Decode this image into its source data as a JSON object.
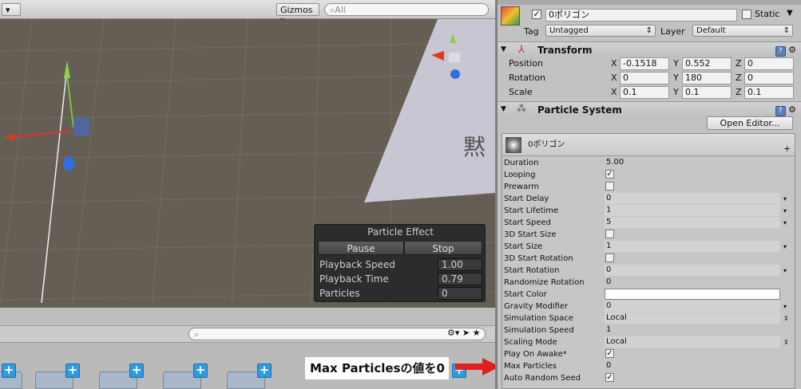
{
  "scene": {
    "gizmos_label": "Gizmos",
    "search_placeholder": "All",
    "background_glyph": "黙"
  },
  "particle_effect": {
    "title": "Particle Effect",
    "pause_label": "Pause",
    "stop_label": "Stop",
    "rows": [
      {
        "label": "Playback Speed",
        "value": "1.00"
      },
      {
        "label": "Playback Time",
        "value": "0.79"
      },
      {
        "label": "Particles",
        "value": "0"
      }
    ]
  },
  "inspector": {
    "object_name": "0ポリゴン",
    "static_label": "Static",
    "tag_label": "Tag",
    "tag_value": "Untagged",
    "layer_label": "Layer",
    "layer_value": "Default",
    "transform": {
      "title": "Transform",
      "rows": [
        {
          "label": "Position",
          "x": "-0.1518",
          "y": "0.552",
          "z": "0"
        },
        {
          "label": "Rotation",
          "x": "0",
          "y": "180",
          "z": "0"
        },
        {
          "label": "Scale",
          "x": "0.1",
          "y": "0.1",
          "z": "0.1"
        }
      ],
      "axis_x": "X",
      "axis_y": "Y",
      "axis_z": "Z"
    },
    "particle_system": {
      "title": "Particle System",
      "open_editor": "Open Editor...",
      "module_name": "0ポリゴン",
      "rows": [
        {
          "label": "Duration",
          "value": "5.00",
          "kind": "text"
        },
        {
          "label": "Looping",
          "value": "✓",
          "kind": "check"
        },
        {
          "label": "Prewarm",
          "value": "",
          "kind": "check"
        },
        {
          "label": "Start Delay",
          "value": "0",
          "kind": "box"
        },
        {
          "label": "Start Lifetime",
          "value": "1",
          "kind": "box"
        },
        {
          "label": "Start Speed",
          "value": "5",
          "kind": "box"
        },
        {
          "label": "3D Start Size",
          "value": "",
          "kind": "check"
        },
        {
          "label": "Start Size",
          "value": "1",
          "kind": "box"
        },
        {
          "label": "3D Start Rotation",
          "value": "",
          "kind": "check"
        },
        {
          "label": "Start Rotation",
          "value": "0",
          "kind": "box"
        },
        {
          "label": "Randomize Rotation",
          "value": "0",
          "kind": "text"
        },
        {
          "label": "Start Color",
          "value": "",
          "kind": "color"
        },
        {
          "label": "Gravity Modifier",
          "value": "0",
          "kind": "box"
        },
        {
          "label": "Simulation Space",
          "value": "Local",
          "kind": "select"
        },
        {
          "label": "Simulation Speed",
          "value": "1",
          "kind": "text"
        },
        {
          "label": "Scaling Mode",
          "value": "Local",
          "kind": "select"
        },
        {
          "label": "Play On Awake*",
          "value": "✓",
          "kind": "check"
        },
        {
          "label": "Max Particles",
          "value": "0",
          "kind": "text"
        },
        {
          "label": "Auto Random Seed",
          "value": "✓",
          "kind": "check"
        }
      ]
    }
  },
  "annotation": {
    "text": "Max Particlesの値を0",
    "arrow_color": "#e02020"
  }
}
